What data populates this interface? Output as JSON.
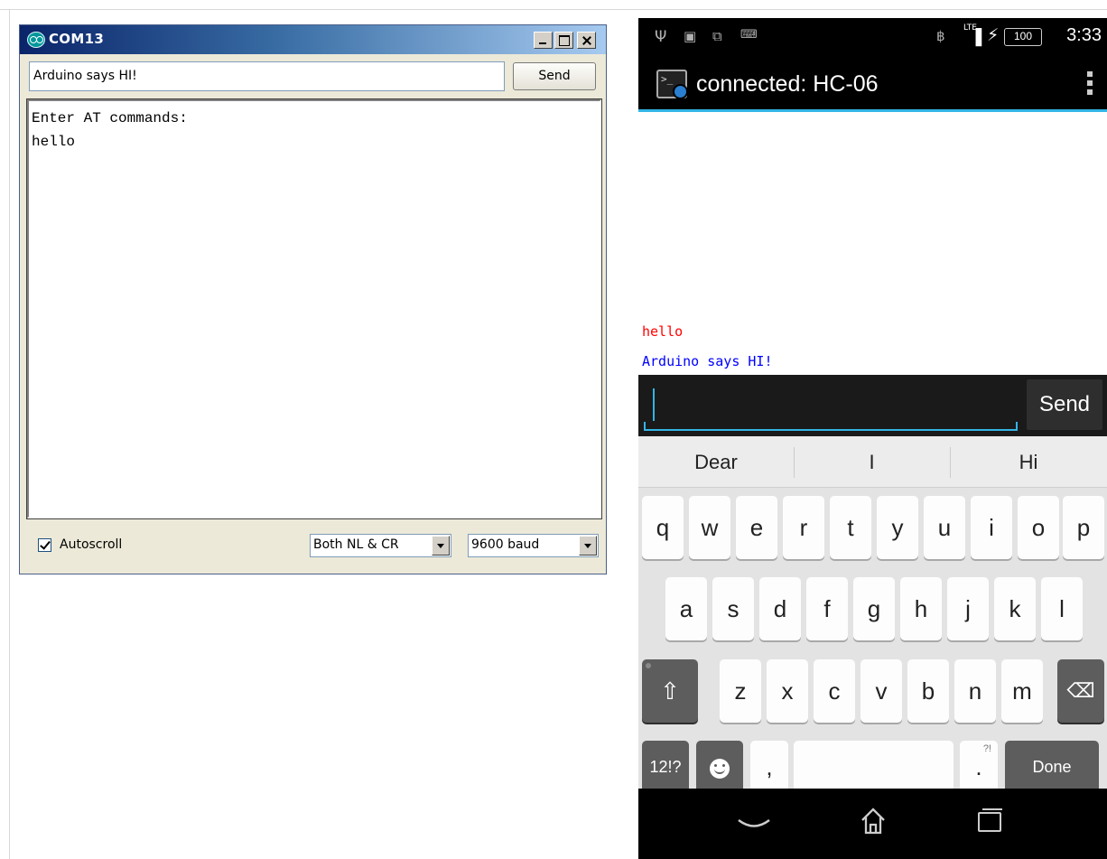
{
  "serial_monitor": {
    "title": "COM13",
    "input_value": "Arduino says HI!",
    "send_label": "Send",
    "output_lines": [
      "Enter AT commands:",
      "hello"
    ],
    "autoscroll_label": "Autoscroll",
    "autoscroll_checked": true,
    "line_ending": "Both NL & CR",
    "baud_rate": "9600 baud"
  },
  "phone": {
    "status_bar": {
      "time": "3:33",
      "battery": "100",
      "network": "LTE"
    },
    "action_bar": {
      "title": "connected: HC-06"
    },
    "terminal": {
      "received": "hello",
      "sent": "Arduino says HI!",
      "received_color": "#ff0000",
      "sent_color": "#0000ff"
    },
    "input": {
      "value": "",
      "send_label": "Send"
    },
    "keyboard": {
      "suggestions": [
        "Dear",
        "I",
        "Hi"
      ],
      "row1": [
        "q",
        "w",
        "e",
        "r",
        "t",
        "y",
        "u",
        "i",
        "o",
        "p"
      ],
      "row2": [
        "a",
        "s",
        "d",
        "f",
        "g",
        "h",
        "j",
        "k",
        "l"
      ],
      "row3": [
        "z",
        "x",
        "c",
        "v",
        "b",
        "n",
        "m"
      ],
      "symbols_label": "12!?",
      "comma_label": ",",
      "period_label": ".",
      "period_hint": "?!",
      "done_label": "Done"
    },
    "accent_color": "#33b5e5"
  }
}
